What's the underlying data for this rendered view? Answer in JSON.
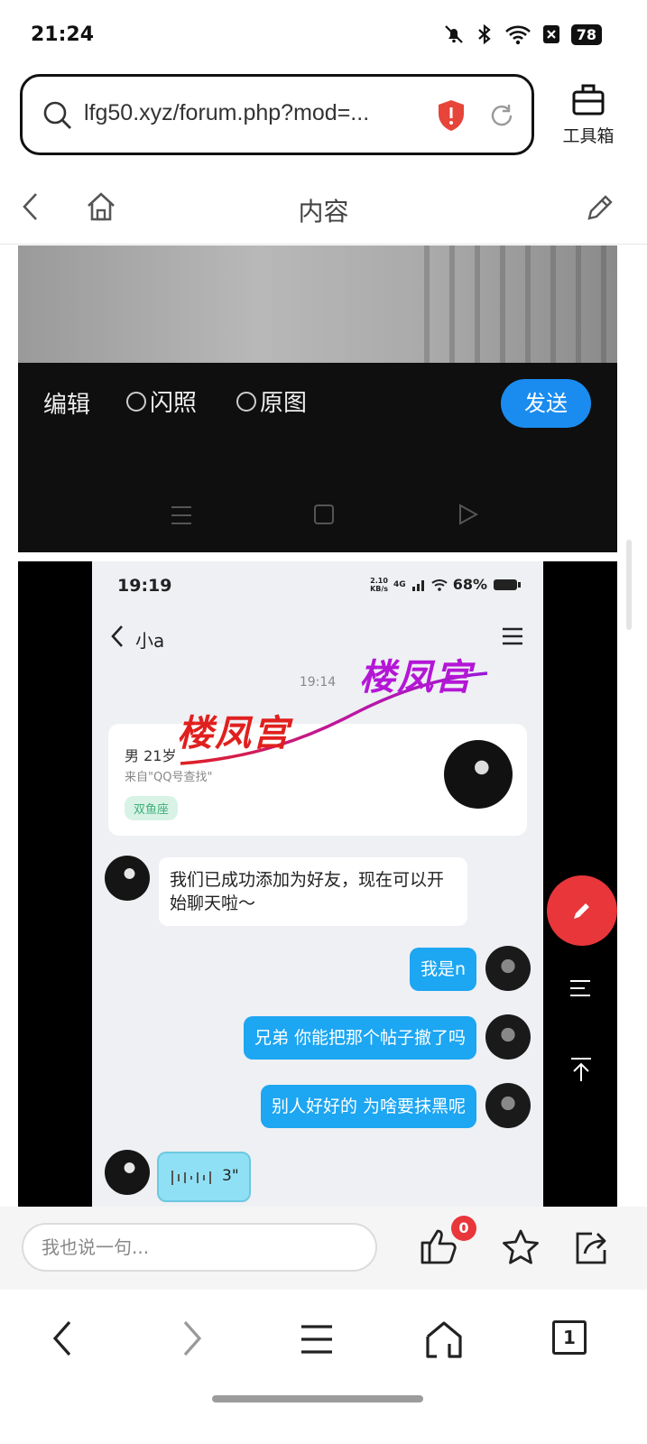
{
  "status": {
    "time": "21:24",
    "battery": "78"
  },
  "url_bar": {
    "url": "lfg50.xyz/forum.php?mod=..."
  },
  "toolbox": {
    "label": "工具箱"
  },
  "header": {
    "title": "内容"
  },
  "camera_screen": {
    "edit_label": "编辑",
    "flash_label": "闪照",
    "original_label": "原图",
    "send_label": "发送"
  },
  "chat": {
    "time": "19:19",
    "network_speed_top": "2.10",
    "network_speed_bottom": "KB/s",
    "network_type": "4G",
    "battery": "68%",
    "contact_name": "小a",
    "message_time": "19:14",
    "card": {
      "gender_age": "男  21岁",
      "source": "来自\"QQ号查找\"",
      "tag": "双鱼座"
    },
    "system_message": "我们已成功添加为好友，现在可以开始聊天啦～",
    "messages": [
      "我是n",
      "兄弟 你能把那个帖子撤了吗",
      "别人好好的 为啥要抹黑呢"
    ],
    "voice_duration": "3\"",
    "watermark": "楼凤宫"
  },
  "comment_bar": {
    "placeholder": "我也说一句...",
    "like_count": "0"
  },
  "bottom_nav": {
    "tab_count": "1"
  }
}
